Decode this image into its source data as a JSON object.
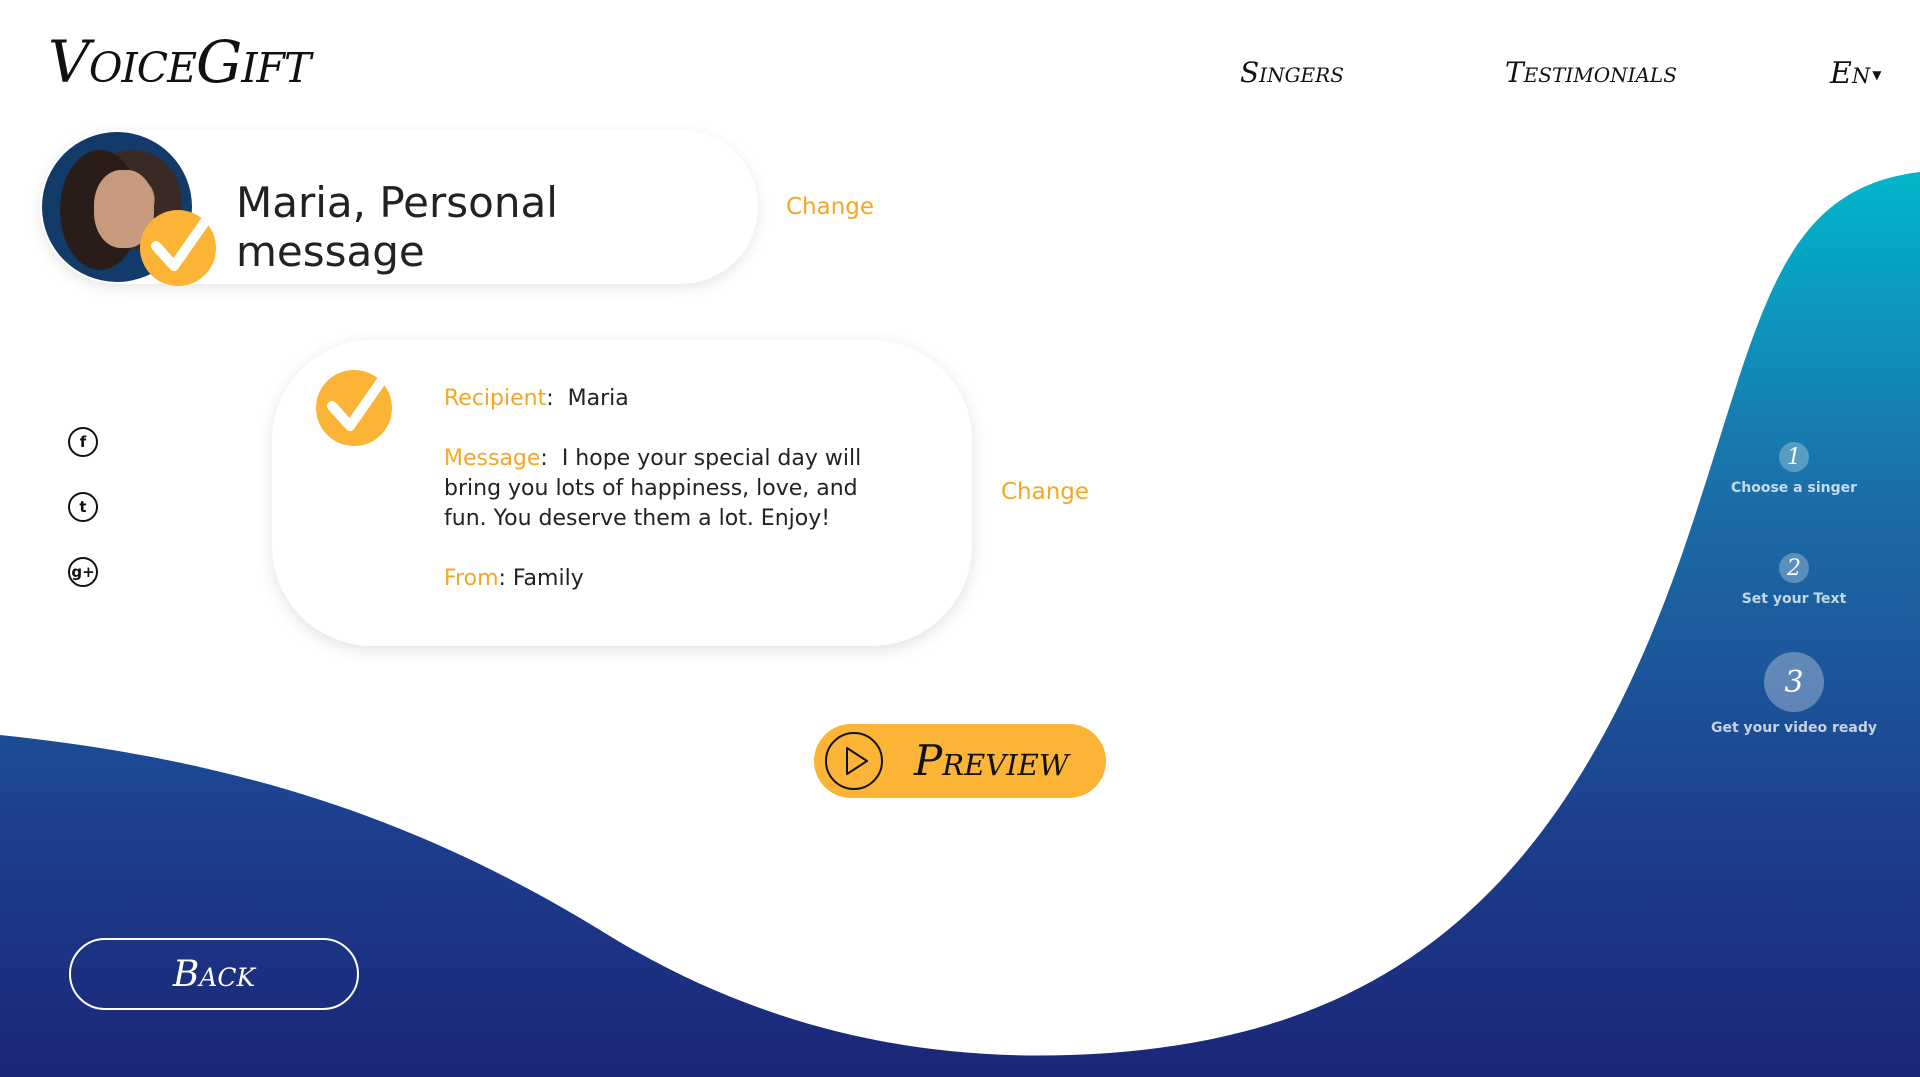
{
  "brand": {
    "logo": "VoiceGift"
  },
  "nav": {
    "singers": "Singers",
    "testimonials": "Testimonials",
    "language": "En"
  },
  "singer_card": {
    "title": "Maria, Personal message",
    "change": "Change"
  },
  "message_card": {
    "recipient_label": "Recipient",
    "recipient_value": "Maria",
    "message_label": "Message",
    "message_value": "I hope your special day will bring you lots of happiness, love, and fun. You deserve them a lot. Enjoy!",
    "from_label": "From",
    "from_value": "Family",
    "change": "Change"
  },
  "social": {
    "facebook": "f",
    "twitter": "t",
    "google_plus": "g+"
  },
  "preview": {
    "label": "Preview"
  },
  "steps": [
    {
      "num": "1",
      "label": "Choose a singer"
    },
    {
      "num": "2",
      "label": "Set your Text"
    },
    {
      "num": "3",
      "label": "Get your video ready"
    }
  ],
  "back": {
    "label": "Back"
  },
  "colors": {
    "accent": "#fbb435",
    "link": "#f5a623",
    "wave_top": "#00b7cc",
    "wave_bottom": "#1c2677"
  }
}
